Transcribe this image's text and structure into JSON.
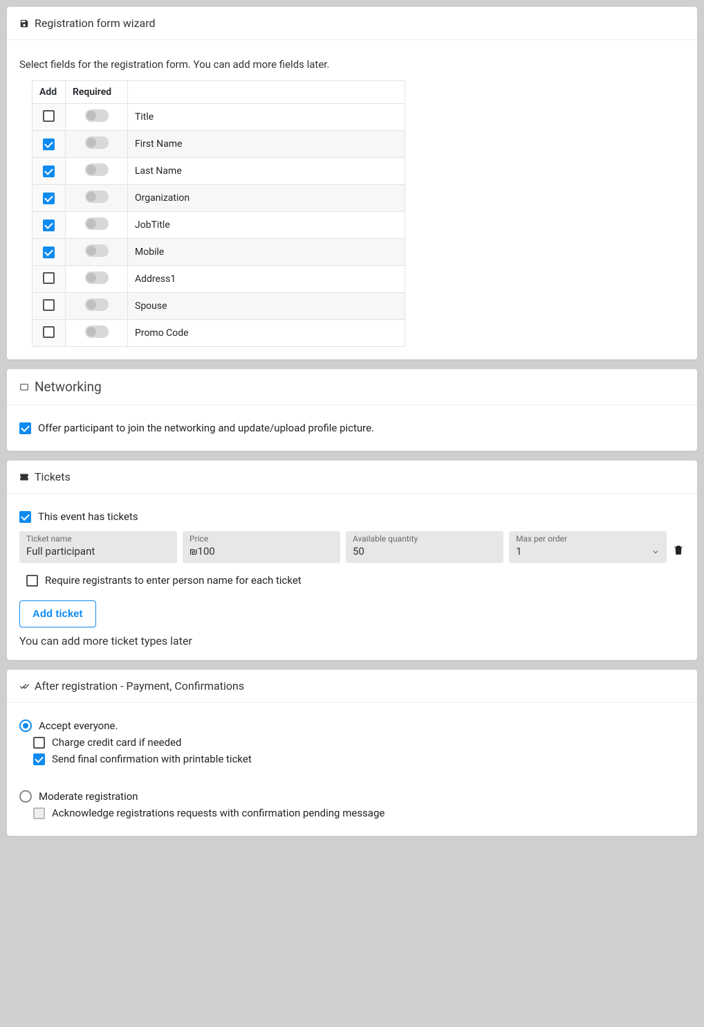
{
  "wizard": {
    "title": "Registration form wizard",
    "instructions": "Select fields for the registration form. You can add more fields later.",
    "headers": {
      "add": "Add",
      "required": "Required"
    },
    "fields": [
      {
        "label": "Title",
        "add": false,
        "required_on": false
      },
      {
        "label": "First Name",
        "add": true,
        "required_on": false
      },
      {
        "label": "Last Name",
        "add": true,
        "required_on": false
      },
      {
        "label": "Organization",
        "add": true,
        "required_on": false
      },
      {
        "label": "JobTitle",
        "add": true,
        "required_on": false
      },
      {
        "label": "Mobile",
        "add": true,
        "required_on": false
      },
      {
        "label": "Address1",
        "add": false,
        "required_on": false
      },
      {
        "label": "Spouse",
        "add": false,
        "required_on": false
      },
      {
        "label": "Promo Code",
        "add": false,
        "required_on": false
      }
    ]
  },
  "networking": {
    "title": "Networking",
    "offer_checked": true,
    "offer_label": "Offer participant to join the networking and update/upload profile picture."
  },
  "tickets": {
    "title": "Tickets",
    "has_tickets_checked": true,
    "has_tickets_label": "This event has tickets",
    "labels": {
      "name": "Ticket name",
      "price": "Price",
      "qty": "Available quantity",
      "max": "Max per order"
    },
    "row": {
      "name": "Full participant",
      "price": "₪100",
      "qty": "50",
      "max": "1"
    },
    "require_names_checked": false,
    "require_names_label": "Require registrants to enter person name for each ticket",
    "add_button": "Add ticket",
    "hint": "You can add more ticket types later"
  },
  "after": {
    "title": "After registration - Payment, Confirmations",
    "accept": {
      "selected": true,
      "label": "Accept everyone.",
      "charge_checked": false,
      "charge_label": "Charge credit card if needed",
      "send_checked": true,
      "send_label": "Send final confirmation with printable ticket"
    },
    "moderate": {
      "selected": false,
      "label": "Moderate registration",
      "ack_checked": false,
      "ack_label": "Acknowledge registrations requests with confirmation pending message"
    }
  }
}
